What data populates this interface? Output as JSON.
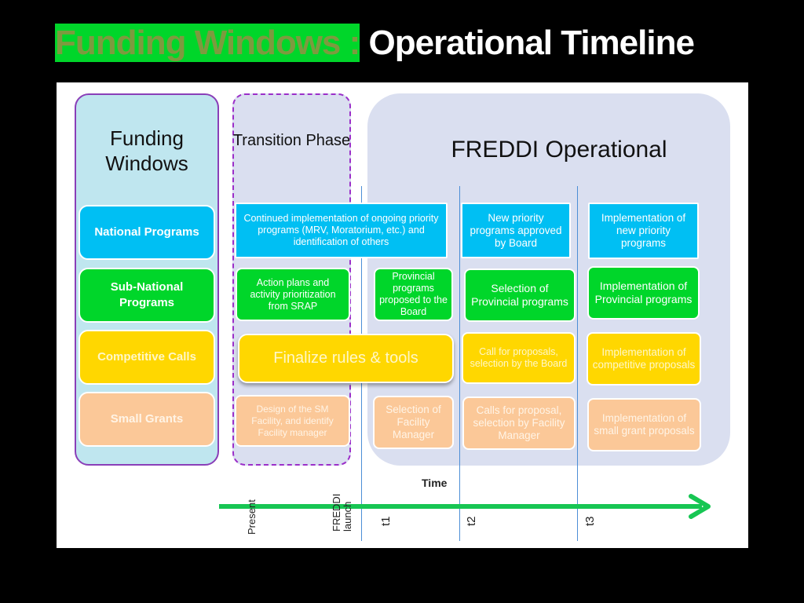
{
  "title": {
    "part1": "Funding Windows :",
    "part2": "Operational Timeline"
  },
  "colors": {
    "title_accent": "#7d9a3f",
    "national": "#00bff3",
    "subnational": "#00d62a",
    "competitive": "#ffd700",
    "small_grants": "#fbc898",
    "timeline_arrow": "#17c653"
  },
  "columns": {
    "funding_windows": "Funding Windows",
    "transition": "Transition Phase",
    "operational": "FREDDI Operational"
  },
  "categories": [
    "National Programs",
    "Sub-National Programs",
    "Competitive Calls",
    "Small Grants"
  ],
  "national": {
    "transition": "Continued implementation of ongoing priority programs (MRV, Moratorium, etc.) and identification of others",
    "t2": "New priority programs approved by Board",
    "t3": "Implementation of new priority programs"
  },
  "subnational": {
    "transition": "Action plans and activity prioritization from SRAP",
    "t1": "Provincial programs proposed to the Board",
    "t2": "Selection of Provincial programs",
    "t3": "Implementation of Provincial programs"
  },
  "competitive": {
    "transition": "Finalize rules & tools",
    "t2": "Call for proposals, selection by the Board",
    "t3": "Implementation of competitive proposals"
  },
  "small_grants": {
    "transition": "Design of the SM Facility, and identify Facility manager",
    "t1": "Selection of Facility Manager",
    "t2": "Calls for proposal, selection by Facility Manager",
    "t3": "Implementation of small grant proposals"
  },
  "timeline": {
    "axis_label": "Time",
    "markers": [
      "Present",
      "FREDDI launch",
      "t1",
      "t2",
      "t3"
    ]
  }
}
